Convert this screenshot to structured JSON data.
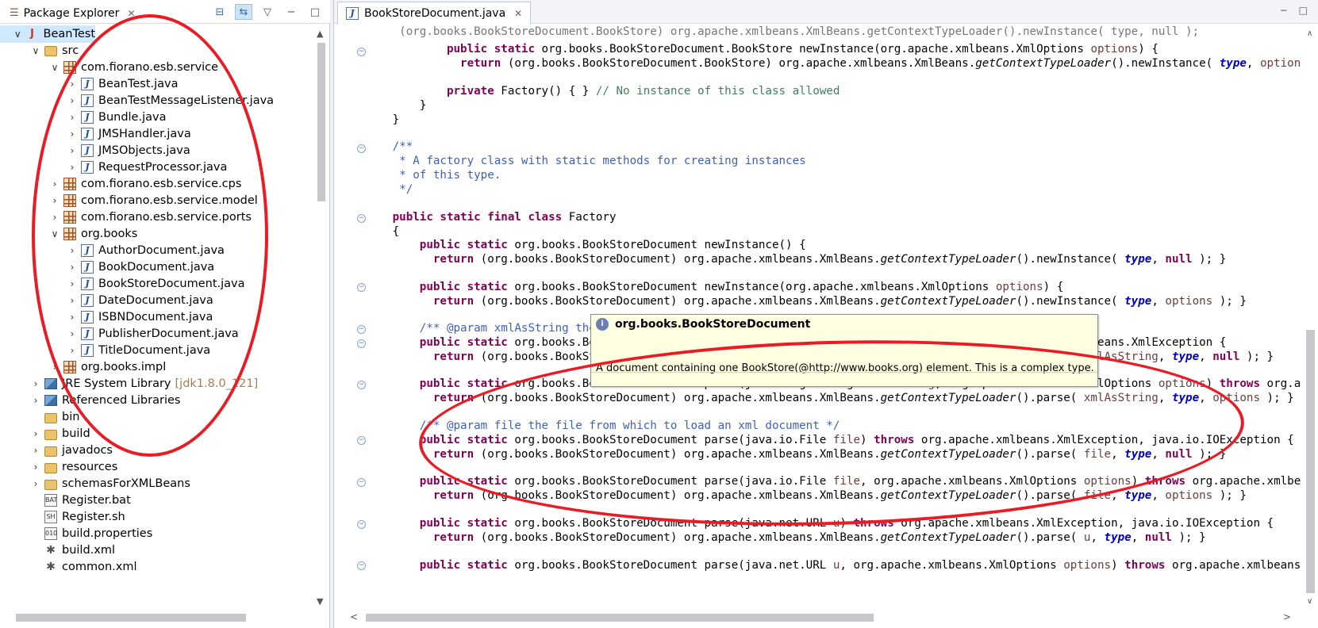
{
  "package_explorer": {
    "title": "Package Explorer",
    "tree": [
      {
        "label": "BeanTest",
        "icon": "project-icon",
        "expanded": true,
        "level": 0,
        "selected": true
      },
      {
        "label": "src",
        "icon": "source-folder-icon",
        "expanded": true,
        "level": 1
      },
      {
        "label": "com.fiorano.esb.service",
        "icon": "package-icon",
        "expanded": true,
        "level": 2
      },
      {
        "label": "BeanTest.java",
        "icon": "java-file-icon",
        "level": 3
      },
      {
        "label": "BeanTestMessageListener.java",
        "icon": "java-file-icon",
        "level": 3
      },
      {
        "label": "Bundle.java",
        "icon": "java-file-icon",
        "level": 3
      },
      {
        "label": "JMSHandler.java",
        "icon": "java-file-icon",
        "level": 3
      },
      {
        "label": "JMSObjects.java",
        "icon": "java-file-icon",
        "level": 3
      },
      {
        "label": "RequestProcessor.java",
        "icon": "java-file-icon",
        "level": 3
      },
      {
        "label": "com.fiorano.esb.service.cps",
        "icon": "package-icon",
        "level": 2
      },
      {
        "label": "com.fiorano.esb.service.model",
        "icon": "package-icon",
        "level": 2
      },
      {
        "label": "com.fiorano.esb.service.ports",
        "icon": "package-icon",
        "level": 2
      },
      {
        "label": "org.books",
        "icon": "package-icon",
        "expanded": true,
        "level": 2
      },
      {
        "label": "AuthorDocument.java",
        "icon": "java-file-icon",
        "level": 3
      },
      {
        "label": "BookDocument.java",
        "icon": "java-file-icon",
        "level": 3
      },
      {
        "label": "BookStoreDocument.java",
        "icon": "java-file-icon",
        "level": 3
      },
      {
        "label": "DateDocument.java",
        "icon": "java-file-icon",
        "level": 3
      },
      {
        "label": "ISBNDocument.java",
        "icon": "java-file-icon",
        "level": 3
      },
      {
        "label": "PublisherDocument.java",
        "icon": "java-file-icon",
        "level": 3
      },
      {
        "label": "TitleDocument.java",
        "icon": "java-file-icon",
        "level": 3
      },
      {
        "label": "org.books.impl",
        "icon": "package-icon",
        "level": 2
      },
      {
        "label": "JRE System Library",
        "suffix": "[jdk1.8.0_121]",
        "icon": "library-icon",
        "level": 1
      },
      {
        "label": "Referenced Libraries",
        "icon": "library-icon",
        "level": 1
      },
      {
        "label": "bin",
        "icon": "folder-icon",
        "level": 1,
        "noarrow": true
      },
      {
        "label": "build",
        "icon": "folder-icon",
        "level": 1
      },
      {
        "label": "javadocs",
        "icon": "folder-icon",
        "level": 1
      },
      {
        "label": "resources",
        "icon": "folder-icon",
        "level": 1
      },
      {
        "label": "schemasForXMLBeans",
        "icon": "folder-icon",
        "level": 1
      },
      {
        "label": "Register.bat",
        "icon": "bat-file-icon",
        "level": 1,
        "noarrow": true
      },
      {
        "label": "Register.sh",
        "icon": "sh-file-icon",
        "level": 1,
        "noarrow": true
      },
      {
        "label": "build.properties",
        "icon": "properties-file-icon",
        "level": 1,
        "noarrow": true
      },
      {
        "label": "build.xml",
        "icon": "xml-file-icon",
        "level": 1,
        "noarrow": true
      },
      {
        "label": "common.xml",
        "icon": "xml-file-icon",
        "level": 1,
        "noarrow": true
      }
    ]
  },
  "editor": {
    "tab_title": "BookStoreDocument.java",
    "hover": {
      "title": "org.books.BookStoreDocument",
      "body": "A document containing one BookStore(@http://www.books.org) element. This is a complex type."
    }
  }
}
